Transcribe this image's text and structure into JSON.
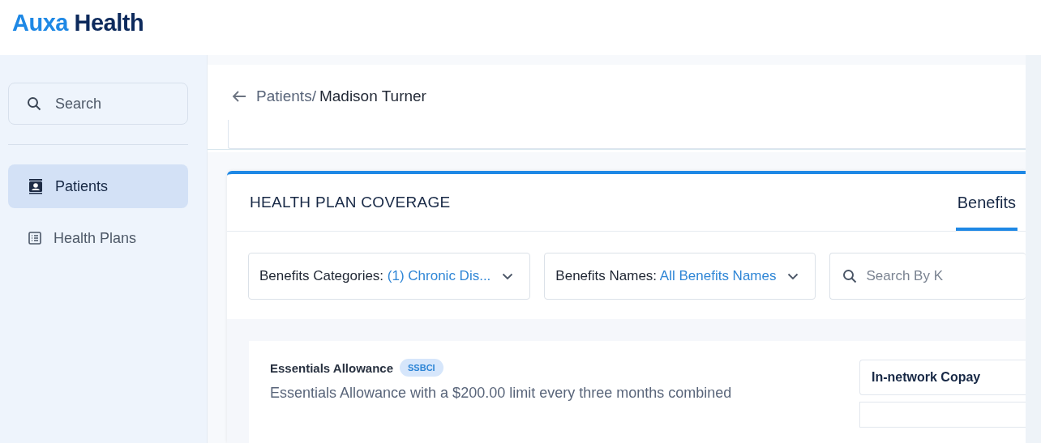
{
  "brand": {
    "part1": "Auxa",
    "part2": "Health"
  },
  "sidebar": {
    "search": {
      "placeholder": "Search"
    },
    "items": [
      {
        "label": "Patients",
        "kind": "person",
        "selected": true
      },
      {
        "label": "Health Plans",
        "kind": "list",
        "selected": false
      }
    ]
  },
  "breadcrumb": {
    "parent": "Patients/",
    "current": "Madison Turner"
  },
  "coverage": {
    "title": "HEALTH PLAN COVERAGE",
    "tabs": [
      {
        "label": "Benefits",
        "selected": true
      }
    ],
    "filters": [
      {
        "kind": "dropdown",
        "label": "Benefits Categories:",
        "value": "(1) Chronic Dis..."
      },
      {
        "kind": "dropdown",
        "label": "Benefits Names:",
        "value": "All Benefits Names"
      },
      {
        "kind": "search",
        "placeholder": "Search By K"
      }
    ],
    "benefit": {
      "name": "Essentials Allowance",
      "tag": "SSBCI",
      "description": "Essentials Allowance with a $200.00 limit every three months combined",
      "copay_label": "In-network Copay"
    }
  }
}
